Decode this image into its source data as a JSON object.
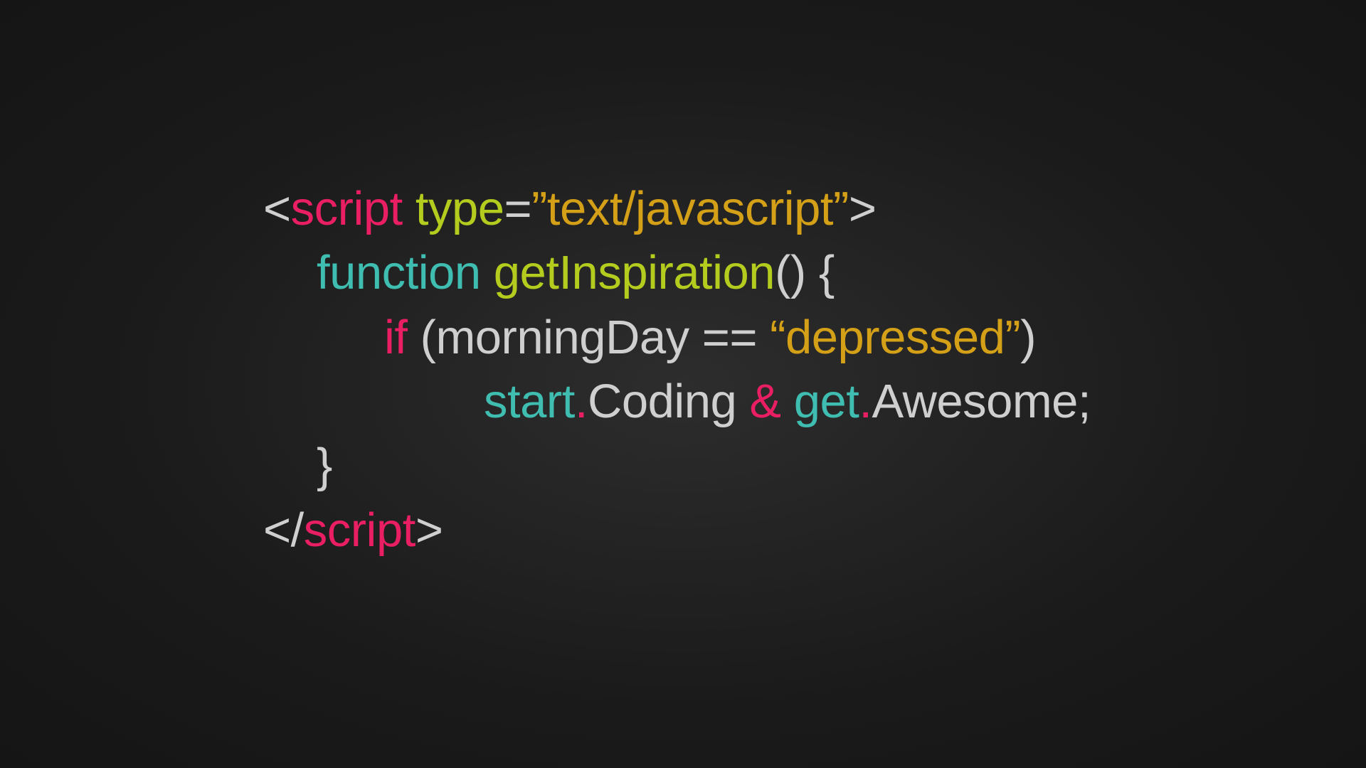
{
  "code": {
    "line1": {
      "open": "<",
      "tag": "script",
      "space": " ",
      "attr": "type",
      "eq": "=",
      "value": "”text/javascript”",
      "close": ">"
    },
    "line2": {
      "keyword": "function",
      "space": " ",
      "name": "getInspiration",
      "parens": "()",
      "space2": " ",
      "brace": "{"
    },
    "line3": {
      "if": "if",
      "space": " ",
      "open": "(",
      "var": "morningDay",
      "space2": " ",
      "op": "==",
      "space3": " ",
      "str": "“depressed”",
      "close": ")"
    },
    "line4": {
      "obj1": "start",
      "dot1": ".",
      "prop1": "Coding",
      "space1": " ",
      "amp": "&",
      "space2": " ",
      "obj2": "get",
      "dot2": ".",
      "prop2": "Awesome",
      "semi": ";"
    },
    "line5": {
      "brace": "}"
    },
    "line6": {
      "open": "</",
      "tag": "script",
      "close": ">"
    }
  }
}
